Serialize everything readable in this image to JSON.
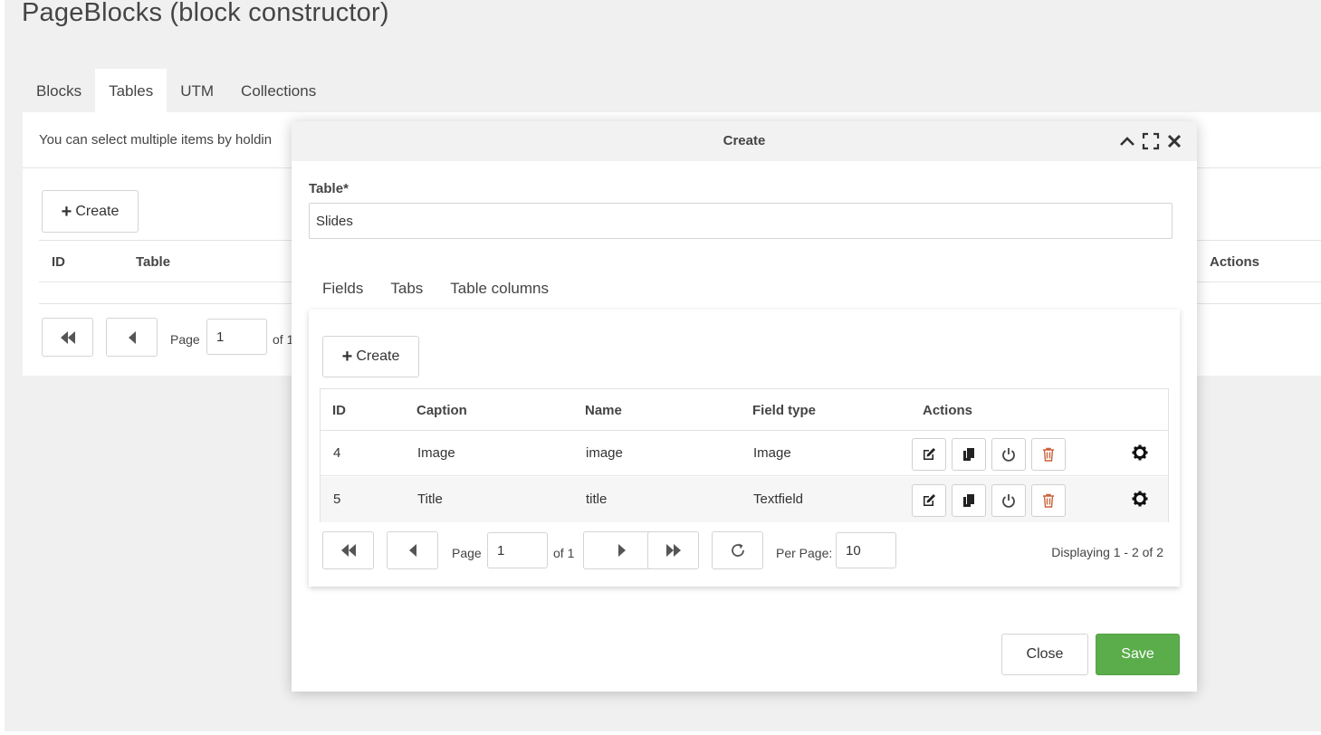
{
  "page": {
    "title": "PageBlocks (block constructor)"
  },
  "main_tabs": [
    {
      "label": "Blocks",
      "active": false
    },
    {
      "label": "Tables",
      "active": true
    },
    {
      "label": "UTM",
      "active": false
    },
    {
      "label": "Collections",
      "active": false
    }
  ],
  "background": {
    "hint": "You can select multiple items by holdin",
    "create_label": "Create",
    "columns": {
      "id": "ID",
      "table": "Table",
      "actions": "Actions"
    },
    "pager": {
      "page_label": "Page",
      "page_value": "1",
      "of_label": "of 1"
    }
  },
  "modal": {
    "title": "Create",
    "table_label": "Table*",
    "table_value": "Slides",
    "tabs": [
      {
        "label": "Fields",
        "active": true
      },
      {
        "label": "Tabs",
        "active": false
      },
      {
        "label": "Table columns",
        "active": false
      }
    ],
    "create_label": "Create",
    "columns": {
      "id": "ID",
      "caption": "Caption",
      "name": "Name",
      "field_type": "Field type",
      "actions": "Actions"
    },
    "rows": [
      {
        "id": "4",
        "caption": "Image",
        "name": "image",
        "field_type": "Image"
      },
      {
        "id": "5",
        "caption": "Title",
        "name": "title",
        "field_type": "Textfield"
      }
    ],
    "pager": {
      "page_label": "Page",
      "page_value": "1",
      "of_label": "of 1",
      "per_page_label": "Per Page:",
      "per_page_value": "10",
      "displaying": "Displaying 1 - 2 of 2"
    },
    "close_label": "Close",
    "save_label": "Save"
  },
  "colors": {
    "save": "#5bad4b",
    "delete_icon": "#c9623a",
    "background": "#f0f0f0"
  }
}
